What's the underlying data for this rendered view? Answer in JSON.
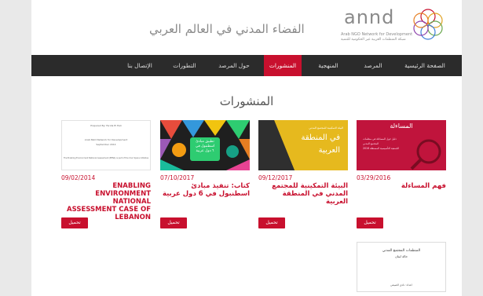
{
  "header": {
    "site_title": "الفضاء المدني في العالم العربي",
    "logo_word": "annd",
    "logo_sub_en": "Arab NGO Network for Development",
    "logo_sub_ar": "شبكة المنظمات العربية غير الحكومية للتنمية"
  },
  "nav": {
    "items": [
      {
        "label": "الصفحة الرئيسية",
        "active": false
      },
      {
        "label": "المرصد",
        "active": false
      },
      {
        "label": "المنهجية",
        "active": false
      },
      {
        "label": "المنشورات",
        "active": true
      },
      {
        "label": "حول المرصد",
        "active": false
      },
      {
        "label": "التطورات",
        "active": false
      },
      {
        "label": "الإتصال بنا",
        "active": false
      }
    ]
  },
  "section_title": "المنشورات",
  "publications": [
    {
      "date": "09/02/2014",
      "title": "ENABLING ENVIRONMENT NATIONAL ASSESSMENT CASE OF LEBANON",
      "download_label": "تحميل",
      "thumb": {
        "lines": [
          "Prepared By: Farida El Hali",
          "Arab NGO Network for Development",
          "September 2014",
          "The Enabling Environment National Assessment (EENA) is part of the Civic Space Initiative"
        ]
      }
    },
    {
      "date": "07/10/2017",
      "title": "كتاب: تنفيذ مبادئ اسطنبول في 6 دول عربية",
      "download_label": "تحميل",
      "thumb": {
        "lines": [
          "تطبيق مبادئ",
          "اسطنبول في",
          "٦ دول عربية"
        ]
      }
    },
    {
      "date": "09/12/2017",
      "title": "البيئة التمكينية للمجتمع المدني في المنطقة العربية",
      "download_label": "تحميل",
      "thumb": {
        "lines": [
          "البيئة التمكينية للمجتمع المدني",
          "في المنطقة",
          "العربية"
        ]
      }
    },
    {
      "date": "03/29/2016",
      "title": "فهم المساءلة",
      "download_label": "تحميل",
      "thumb": {
        "lines": [
          "المساءلة",
          "دليل حول المساءلة في منظمات",
          "المجتمع المدني",
          "الجمعية التأسيسية المستقلة 2016"
        ]
      }
    }
  ],
  "next_item_thumb": {
    "lines": [
      "المنظمات المجتمع المدني",
      "حالة لبنان",
      "اعداد: نادي الصيفي"
    ]
  },
  "colors": {
    "accent": "#c8102e",
    "nav_bg": "#2b2b2b",
    "page_bg": "#e9e9e9"
  }
}
